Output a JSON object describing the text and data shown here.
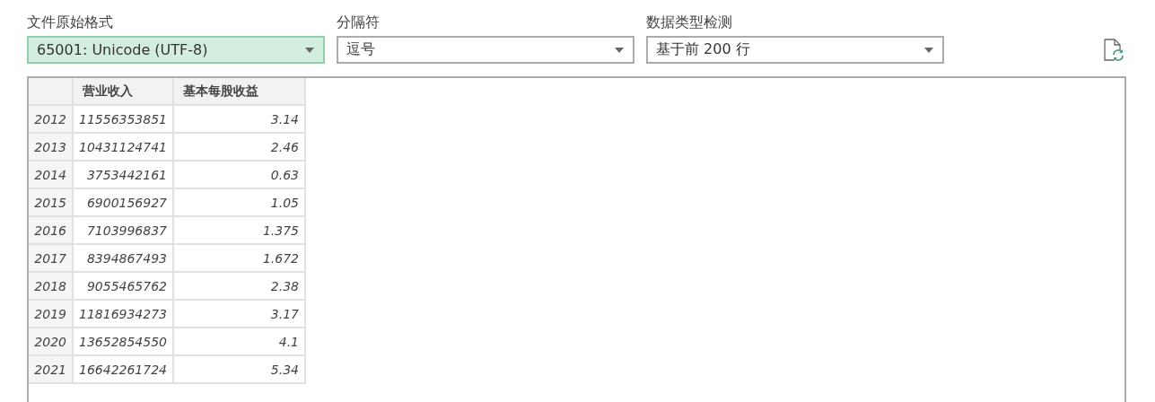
{
  "settings": [
    {
      "label": "文件原始格式",
      "value": "65001: Unicode (UTF-8)",
      "focused": true
    },
    {
      "label": "分隔符",
      "value": "逗号",
      "focused": false
    },
    {
      "label": "数据类型检测",
      "value": "基于前 200 行",
      "focused": false
    }
  ],
  "table": {
    "columns": [
      "营业收入",
      "基本每股收益"
    ],
    "rows": [
      {
        "index": "2012",
        "cells": [
          "11556353851",
          "3.14"
        ]
      },
      {
        "index": "2013",
        "cells": [
          "10431124741",
          "2.46"
        ]
      },
      {
        "index": "2014",
        "cells": [
          "3753442161",
          "0.63"
        ]
      },
      {
        "index": "2015",
        "cells": [
          "6900156927",
          "1.05"
        ]
      },
      {
        "index": "2016",
        "cells": [
          "7103996837",
          "1.375"
        ]
      },
      {
        "index": "2017",
        "cells": [
          "8394867493",
          "1.672"
        ]
      },
      {
        "index": "2018",
        "cells": [
          "9055465762",
          "2.38"
        ]
      },
      {
        "index": "2019",
        "cells": [
          "11816934273",
          "3.17"
        ]
      },
      {
        "index": "2020",
        "cells": [
          "13652854550",
          "4.1"
        ]
      },
      {
        "index": "2021",
        "cells": [
          "16642261724",
          "5.34"
        ]
      }
    ]
  }
}
